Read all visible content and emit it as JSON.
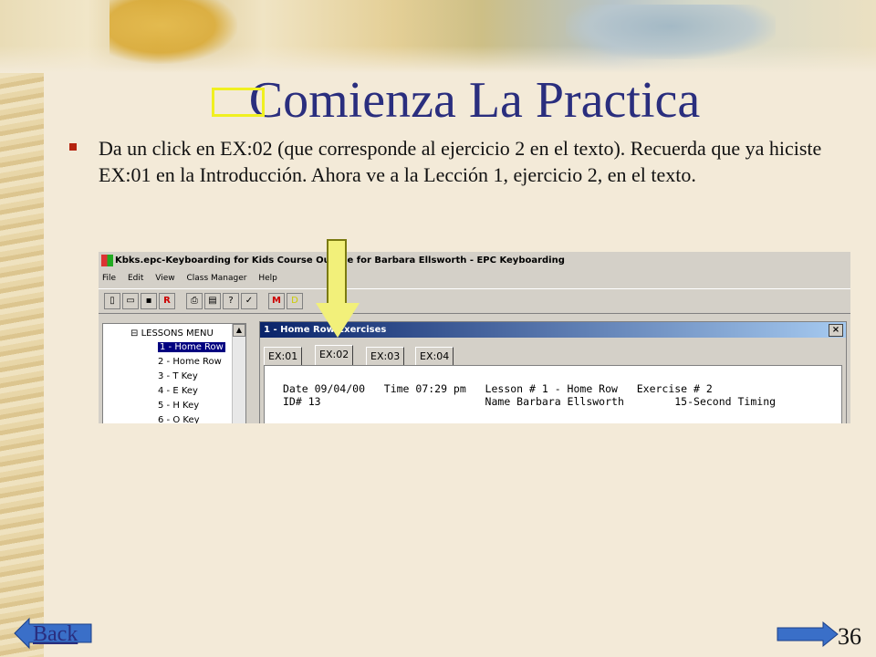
{
  "slide": {
    "title": "Comienza La Practica",
    "bullet": "Da un click en EX:02 (que corresponde al ejercicio 2 en el texto).  Recuerda que ya hiciste EX:01 en la Introducción.  Ahora ve a la Lección 1, ejercicio 2, en el texto.",
    "page_number": "36",
    "back_label": "Back"
  },
  "app": {
    "window_title": "Kbks.epc-Keyboarding for Kids Course Outline for Barbara Ellsworth - EPC Keyboarding",
    "menu": [
      "File",
      "Edit",
      "View",
      "Class Manager",
      "Help"
    ],
    "tree": {
      "header": "LESSONS MENU",
      "items": [
        "1 - Home Row",
        "2 - Home Row",
        "3 - T Key",
        "4 - E Key",
        "5 - H Key",
        "6 - O Key"
      ]
    },
    "child_window": {
      "title": "1 - Home Row Exercises",
      "close": "×",
      "tabs": [
        "EX:01",
        "EX:02",
        "EX:03",
        "EX:04"
      ],
      "line1": "Date 09/04/00   Time 07:29 pm   Lesson # 1 - Home Row   Exercise # 2",
      "line2": "ID# 13                          Name Barbara Ellsworth        15-Second Timing"
    }
  },
  "colors": {
    "title": "#2a2e7e",
    "bullet": "#b5230f",
    "highlight": "#f0f020",
    "arrow": "#f2f07a",
    "nav": "#3a6fc8"
  }
}
